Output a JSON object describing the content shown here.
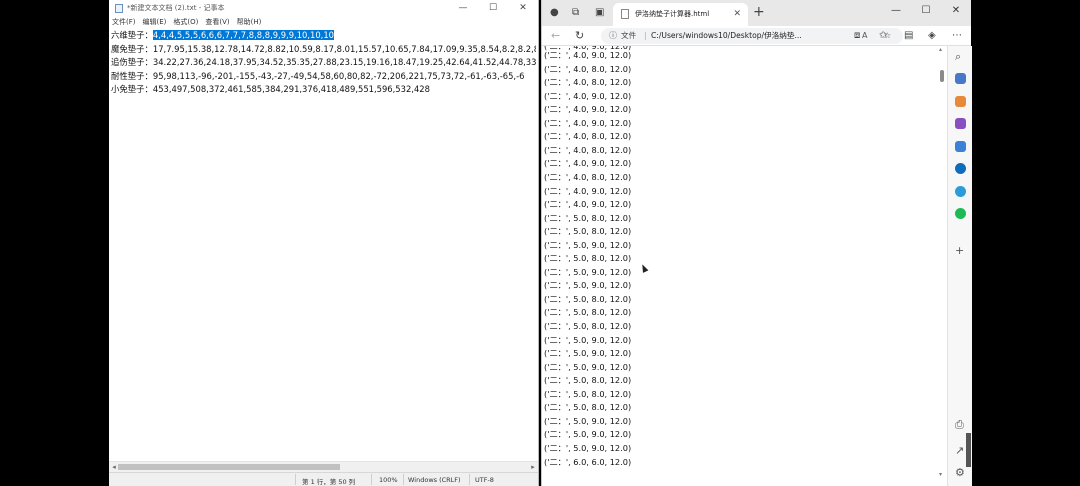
{
  "notepad": {
    "title": "*新建文本文档 (2).txt - 记事本",
    "window_controls": [
      "—",
      "☐",
      "✕"
    ],
    "menu": [
      "文件(F)",
      "编辑(E)",
      "格式(O)",
      "查看(V)",
      "帮助(H)"
    ],
    "lines": [
      {
        "label": "六维垫子：",
        "value": "4,4,4,5,5,5,6,6,6,7,7,7,8,8,8,9,9,9,10,10,10",
        "selected": true
      },
      {
        "label": "魔免垫子：",
        "value": "17,7.95,15.38,12.78,14.72,8.82,10.59,8.17,8.01,15.57,10.65,7.84,17.09,9.35,8.54,8.2,8.2,8",
        "selected": false
      },
      {
        "label": "追伤垫子：",
        "value": "34.22,27.36,24.18,37.95,34.52,35.35,27.88,23.15,19.16,18.47,19.25,42.64,41.52,44.78,33",
        "selected": false
      },
      {
        "label": "耐性垫子：",
        "value": "95,98,113,-96,-201,-155,-43,-27,-49,54,58,60,80,82,-72,206,221,75,73,72,-61,-63,-65,-6",
        "selected": false
      },
      {
        "label": "小免垫子：",
        "value": "453,497,508,372,461,585,384,291,376,418,489,551,596,532,428",
        "selected": false
      }
    ],
    "status": {
      "position": "第 1 行，第 50 列",
      "zoom": "100%",
      "line_ending": "Windows (CRLF)",
      "encoding": "UTF-8"
    }
  },
  "browser": {
    "tab_title": "伊洛纳垫子计算器.html",
    "url_label": "文件",
    "url": "C:/Users/windows10/Desktop/伊洛纳垫...",
    "output_prefix": "('二：',",
    "output_lines": [
      "4.0, 9.0, 12.0)",
      "4.0, 8.0, 12.0)",
      "4.0, 8.0, 12.0)",
      "4.0, 9.0, 12.0)",
      "4.0, 9.0, 12.0)",
      "4.0, 9.0, 12.0)",
      "4.0, 8.0, 12.0)",
      "4.0, 8.0, 12.0)",
      "4.0, 9.0, 12.0)",
      "4.0, 8.0, 12.0)",
      "4.0, 9.0, 12.0)",
      "4.0, 9.0, 12.0)",
      "5.0, 8.0, 12.0)",
      "5.0, 8.0, 12.0)",
      "5.0, 9.0, 12.0)",
      "5.0, 8.0, 12.0)",
      "5.0, 9.0, 12.0)",
      "5.0, 9.0, 12.0)",
      "5.0, 8.0, 12.0)",
      "5.0, 8.0, 12.0)",
      "5.0, 8.0, 12.0)",
      "5.0, 9.0, 12.0)",
      "5.0, 9.0, 12.0)",
      "5.0, 9.0, 12.0)",
      "5.0, 8.0, 12.0)",
      "5.0, 8.0, 12.0)",
      "5.0, 8.0, 12.0)",
      "5.0, 9.0, 12.0)",
      "5.0, 9.0, 12.0)",
      "5.0, 9.0, 12.0)",
      "6.0, 6.0, 12.0)"
    ],
    "sidebar_icon_colors": [
      "#4a78c8",
      "#e8883a",
      "#8a4fbf",
      "#3b82d6",
      "#0f6cbd",
      "#2e9bd6",
      "#1db954"
    ]
  }
}
